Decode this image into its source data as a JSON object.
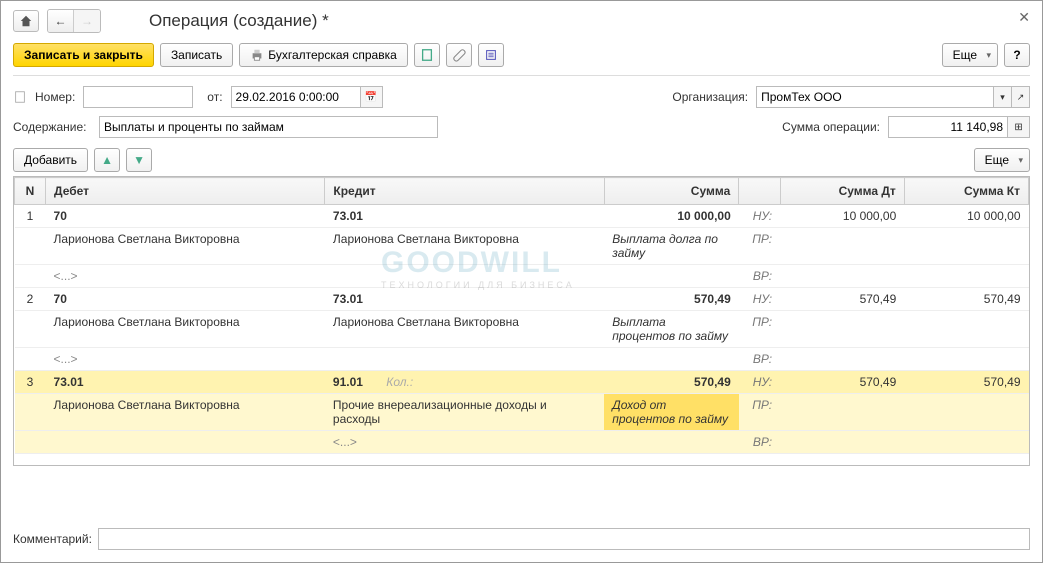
{
  "title": "Операция (создание) *",
  "toolbar": {
    "save_close": "Записать и закрыть",
    "save": "Записать",
    "accounting_ref": "Бухгалтерская справка",
    "more": "Еще",
    "help": "?"
  },
  "fields": {
    "number_label": "Номер:",
    "number_value": "",
    "from_label": "от:",
    "date_value": "29.02.2016 0:00:00",
    "org_label": "Организация:",
    "org_value": "ПромТех ООО",
    "content_label": "Содержание:",
    "content_value": "Выплаты и проценты по займам",
    "sum_label": "Сумма операции:",
    "sum_value": "11 140,98"
  },
  "table_toolbar": {
    "add": "Добавить",
    "more": "Еще"
  },
  "columns": {
    "n": "N",
    "debit": "Дебет",
    "credit": "Кредит",
    "sum": "Сумма",
    "sumdt": "Сумма Дт",
    "sumkt": "Сумма Кт"
  },
  "tags": {
    "nu": "НУ:",
    "pr": "ПР:",
    "vr": "ВР:"
  },
  "rows": [
    {
      "n": "1",
      "debit_acc": "70",
      "debit_sub1": "Ларионова Светлана Викторовна",
      "debit_sub2": "<...>",
      "credit_acc": "73.01",
      "credit_sub1": "Ларионова Светлана Викторовна",
      "credit_sub2": "",
      "sum": "10 000,00",
      "desc": "Выплата долга по займу",
      "sumdt": "10 000,00",
      "sumkt": "10 000,00",
      "selected": false
    },
    {
      "n": "2",
      "debit_acc": "70",
      "debit_sub1": "Ларионова Светлана Викторовна",
      "debit_sub2": "<...>",
      "credit_acc": "73.01",
      "credit_sub1": "Ларионова Светлана Викторовна",
      "credit_sub2": "",
      "sum": "570,49",
      "desc": "Выплата процентов по займу",
      "sumdt": "570,49",
      "sumkt": "570,49",
      "selected": false
    },
    {
      "n": "3",
      "debit_acc": "73.01",
      "debit_sub1": "Ларионова Светлана Викторовна",
      "debit_sub2": "",
      "credit_acc": "91.01",
      "credit_qty": "Кол.:",
      "credit_sub1": "Прочие внереализационные доходы и расходы",
      "credit_sub2": "<...>",
      "sum": "570,49",
      "desc": "Доход от процентов по займу",
      "sumdt": "570,49",
      "sumkt": "570,49",
      "selected": true
    }
  ],
  "comment_label": "Комментарий:",
  "comment_value": "",
  "watermark": "GOODWILL",
  "watermark_sub": "ТЕХНОЛОГИИ ДЛЯ БИЗНЕСА"
}
